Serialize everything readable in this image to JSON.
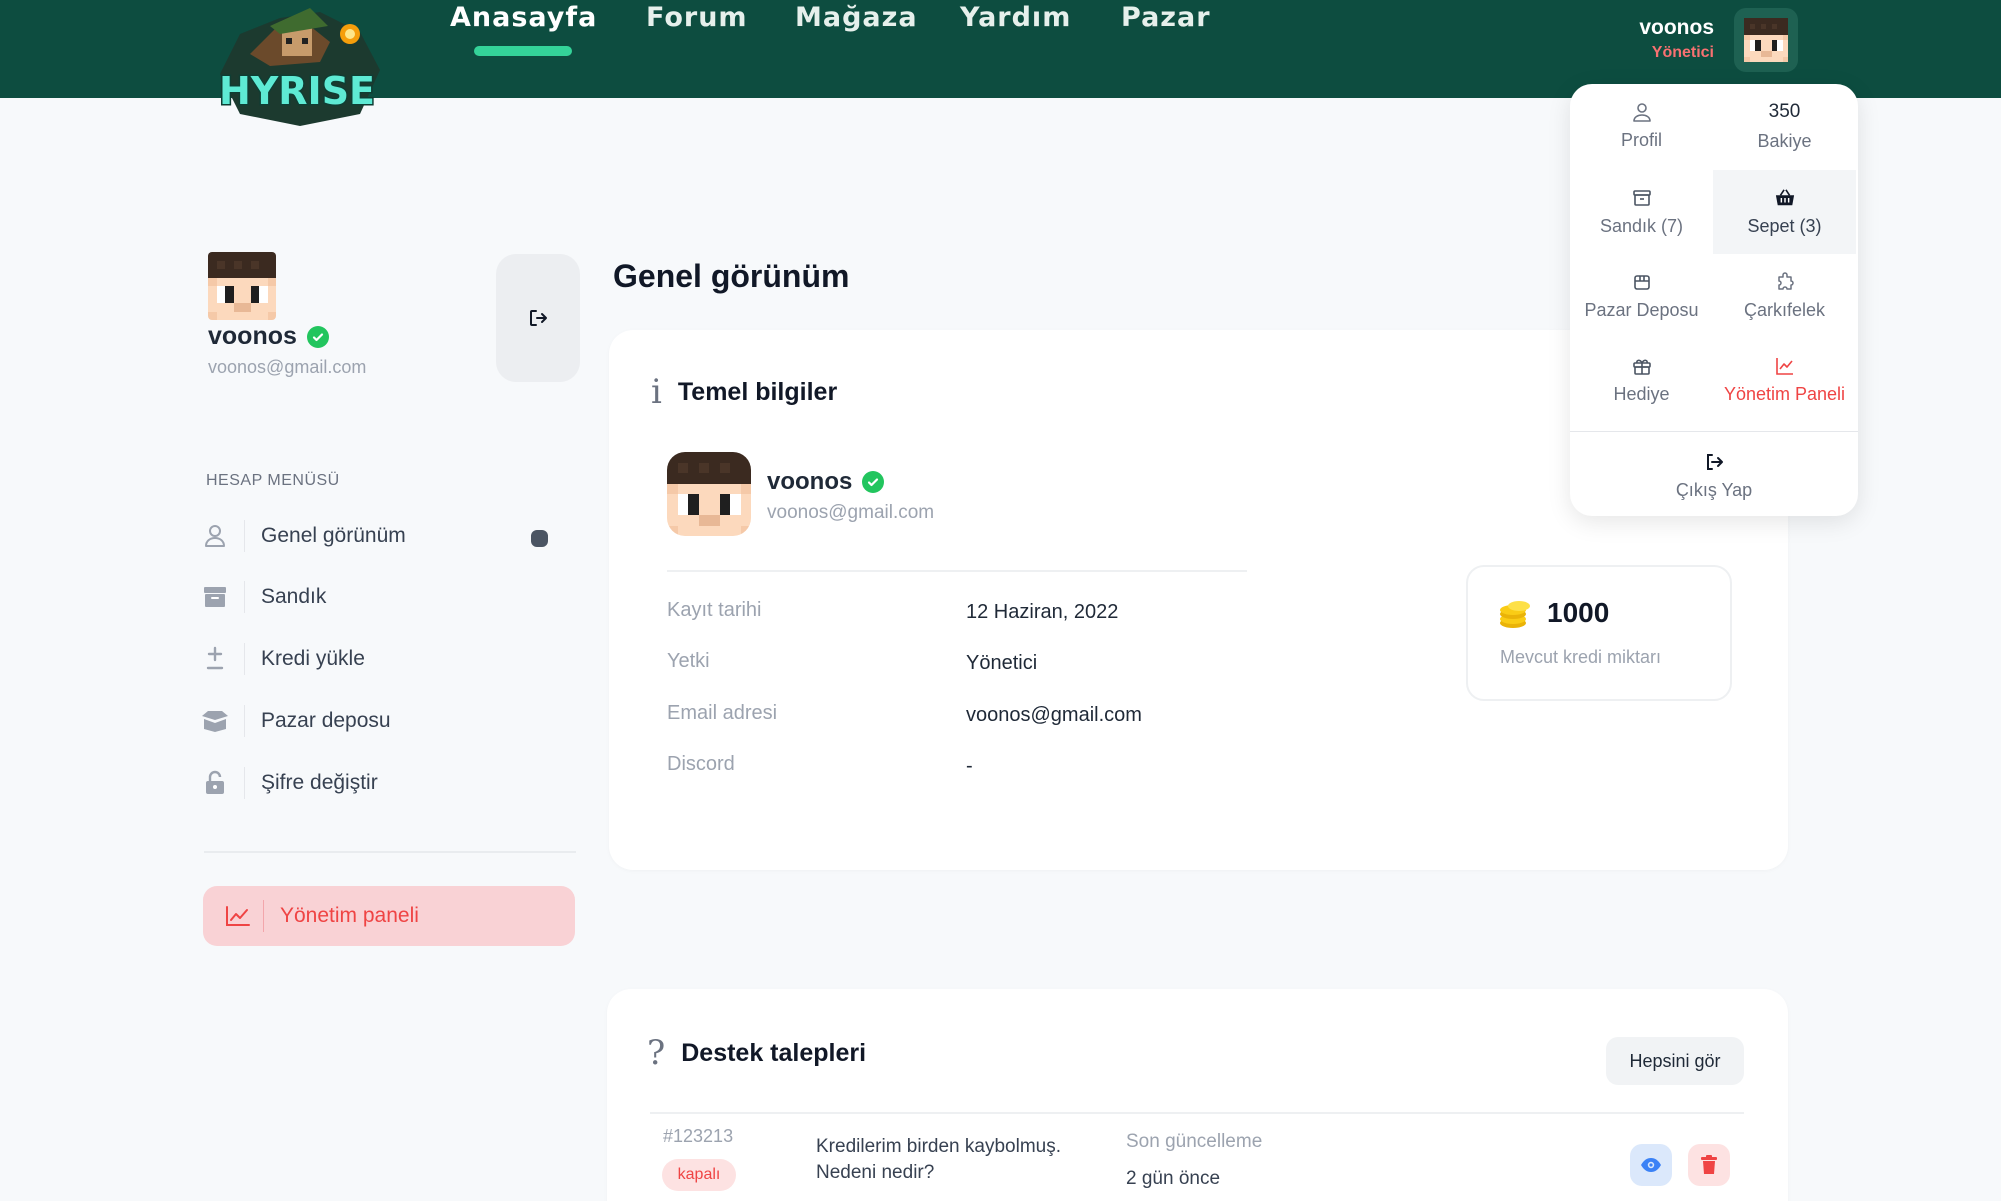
{
  "header": {
    "logo_text": "HYRISE",
    "nav": [
      {
        "label": "Anasayfa",
        "active": true
      },
      {
        "label": "Forum",
        "active": false
      },
      {
        "label": "Mağaza",
        "active": false
      },
      {
        "label": "Yardım",
        "active": false
      },
      {
        "label": "Pazar",
        "active": false
      }
    ],
    "user": {
      "name": "voonos",
      "role": "Yönetici"
    }
  },
  "dropdown": {
    "profile": "Profil",
    "balance_value": "350",
    "balance_label": "Bakiye",
    "chest": "Sandık (7)",
    "cart": "Sepet (3)",
    "market_storage": "Pazar Deposu",
    "wheel": "Çarkıfelek",
    "gift": "Hediye",
    "admin_panel": "Yönetim Paneli",
    "logout": "Çıkış Yap"
  },
  "sidebar": {
    "name": "voonos",
    "email": "voonos@gmail.com",
    "menu_title": "HESAP MENÜSÜ",
    "items": [
      {
        "label": "Genel görünüm",
        "icon": "user-icon"
      },
      {
        "label": "Sandık",
        "icon": "archive-icon"
      },
      {
        "label": "Kredi yükle",
        "icon": "plus-minus-icon"
      },
      {
        "label": "Pazar deposu",
        "icon": "box-icon"
      },
      {
        "label": "Şifre değiştir",
        "icon": "lock-icon"
      }
    ],
    "admin_button": "Yönetim paneli"
  },
  "main": {
    "title": "Genel görünüm",
    "basic_info": {
      "title": "Temel bilgiler",
      "name": "voonos",
      "email": "voonos@gmail.com",
      "rows": [
        {
          "label": "Kayıt tarihi",
          "value": "12 Haziran, 2022"
        },
        {
          "label": "Yetki",
          "value": "Yönetici"
        },
        {
          "label": "Email adresi",
          "value": "voonos@gmail.com"
        },
        {
          "label": "Discord",
          "value": "-"
        }
      ],
      "credit_amount": "1000",
      "credit_label": "Mevcut kredi miktarı"
    },
    "support": {
      "title": "Destek talepleri",
      "see_all": "Hepsini gör",
      "tickets": [
        {
          "id": "#123213",
          "status": "kapalı",
          "text": "Kredilerim birden kaybolmuş. Nedeni nedir?",
          "updated_label": "Son güncelleme",
          "updated_value": "2 gün önce"
        }
      ]
    }
  },
  "colors": {
    "header_bg": "#0d4d40",
    "accent_green": "#34d399",
    "danger": "#ef4444",
    "verified": "#22c55e"
  }
}
